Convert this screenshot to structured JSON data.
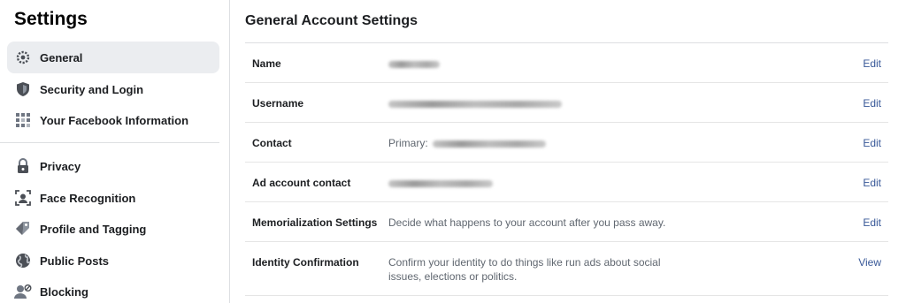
{
  "sidebar": {
    "title": "Settings",
    "items": [
      {
        "label": "General",
        "icon": "gear-icon",
        "active": true
      },
      {
        "label": "Security and Login",
        "icon": "shield-icon"
      },
      {
        "label": "Your Facebook Information",
        "icon": "grid-icon"
      },
      {
        "label": "Privacy",
        "icon": "lock-icon"
      },
      {
        "label": "Face Recognition",
        "icon": "face-recognition-icon"
      },
      {
        "label": "Profile and Tagging",
        "icon": "tag-icon"
      },
      {
        "label": "Public Posts",
        "icon": "globe-icon"
      },
      {
        "label": "Blocking",
        "icon": "blocked-user-icon"
      }
    ]
  },
  "main": {
    "title": "General Account Settings",
    "rows": [
      {
        "label": "Name",
        "value": "",
        "action": "Edit"
      },
      {
        "label": "Username",
        "value": "",
        "action": "Edit"
      },
      {
        "label": "Contact",
        "value": "Primary:",
        "action": "Edit"
      },
      {
        "label": "Ad account contact",
        "value": "",
        "action": "Edit"
      },
      {
        "label": "Memorialization Settings",
        "value": "Decide what happens to your account after you pass away.",
        "action": "Edit"
      },
      {
        "label": "Identity Confirmation",
        "value": "Confirm your identity to do things like run ads about social issues, elections or politics.",
        "action": "View"
      }
    ]
  },
  "colors": {
    "link": "#385898",
    "active_bg": "#ebedf0",
    "divider": "#dddfe2"
  }
}
